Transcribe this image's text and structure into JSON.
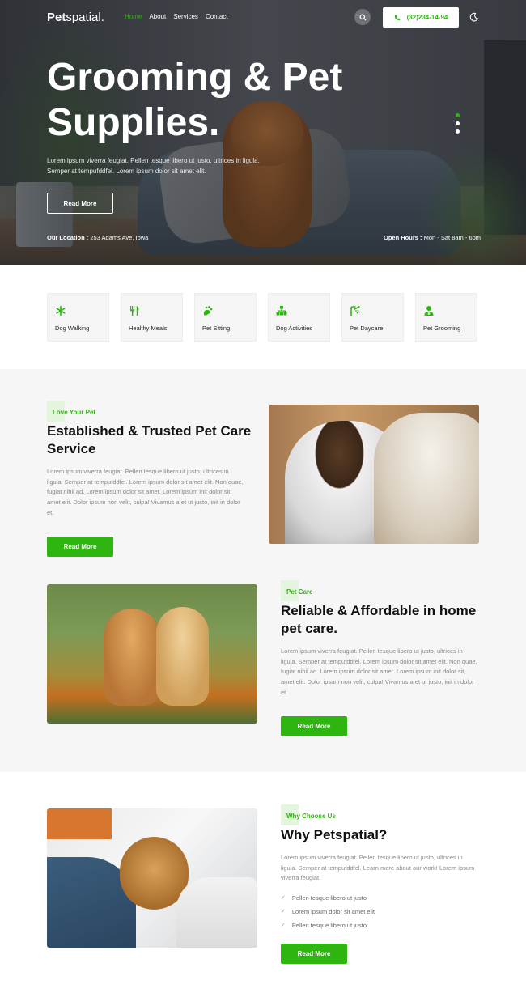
{
  "brand": {
    "name_bold": "Pet",
    "name_rest": "spatial.",
    "accent": "#2fb50f"
  },
  "nav": {
    "items": [
      {
        "label": "Home",
        "active": true
      },
      {
        "label": "About"
      },
      {
        "label": "Services"
      },
      {
        "label": "Contact"
      }
    ],
    "phone": "(32)234-14-94"
  },
  "hero": {
    "title": "Grooming & Pet Supplies.",
    "description": "Lorem ipsum viverra feugiat. Pellen tesque libero ut justo, ultrices in ligula. Semper at tempufddfel. Lorem ipsum dolor sit amet elit.",
    "button": "Read More",
    "location_label": "Our Location :",
    "location_value": " 253 Adams Ave, Iowa",
    "hours_label": "Open Hours :",
    "hours_value": " Mon - Sat 8am - 6pm"
  },
  "services": [
    {
      "label": "Dog Walking",
      "icon": "snowflake-icon"
    },
    {
      "label": "Healthy Meals",
      "icon": "utensils-icon"
    },
    {
      "label": "Pet Sitting",
      "icon": "paw-hand-icon"
    },
    {
      "label": "Dog Activities",
      "icon": "hierarchy-icon"
    },
    {
      "label": "Pet Daycare",
      "icon": "shower-icon"
    },
    {
      "label": "Pet Grooming",
      "icon": "user-badge-icon"
    }
  ],
  "about1": {
    "tag": "Love Your Pet",
    "title": "Established & Trusted Pet Care Service",
    "text": "Lorem ipsum viverra feugiat. Pellen tesque libero ut justo, ultrices in ligula. Semper at tempufddfel. Lorem ipsum dolor sit amet elit. Non quae, fugiat nihil ad. Lorem ipsum dolor sit amet. Lorem ipsum init dolor sit, amet elit. Dolor ipsum non velit, culpa! Vivamus a et ut justo, init in dolor et.",
    "button": "Read More"
  },
  "about2": {
    "tag": "Pet Care",
    "title": "Reliable & Affordable in home pet care.",
    "text": "Lorem ipsum viverra feugiat. Pellen tesque libero ut justo, ultrices in ligula. Semper at tempufddfel. Lorem ipsum dolor sit amet elit. Non quae, fugiat nihil ad. Lorem ipsum dolor sit amet. Lorem ipsum init dolor sit, amet elit. Dolor ipsum non velit, culpa! Vivamus a et ut justo, init in dolor et.",
    "button": "Read More"
  },
  "why": {
    "tag": "Why Choose Us",
    "title": "Why Petspatial?",
    "text": "Lorem ipsum viverra feugiat. Pellen tesque libero ut justo, ultrices in ligula. Semper at tempufddfel. Learn more about our work! Lorem ipsum viverra feugiat.",
    "checks": [
      "Pellen tesque libero ut justo",
      "Lorem ipsum dolor sit amet elit",
      "Pellen tesque libero ut justo"
    ],
    "check_icon": "check-icon",
    "button": "Read More"
  }
}
